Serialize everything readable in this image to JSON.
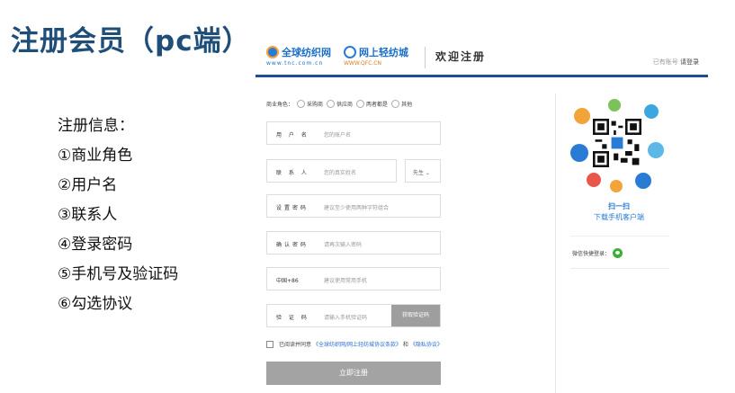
{
  "slide": {
    "title": "注册会员（pc端）",
    "info_heading": "注册信息：",
    "info_items": [
      "①商业角色",
      "②用户名",
      "③联系人",
      "④登录密码",
      "⑤手机号及验证码",
      "⑥勾选协议"
    ]
  },
  "header": {
    "logo1_name": "全球纺织网",
    "logo1_url": "www.tnc.com.cn",
    "logo2_name": "网上轻纺城",
    "logo2_url": "WWW.QFC.CN",
    "welcome": "欢迎注册",
    "login_prompt": "已有账号",
    "login_link": "请登录"
  },
  "form": {
    "role_label": "商业角色：",
    "roles": [
      "采购商",
      "供应商",
      "两者都是",
      "其他"
    ],
    "username": {
      "label": "用 户 名",
      "placeholder": "您的账户名"
    },
    "contact": {
      "label": "联 系 人",
      "placeholder": "您的真实姓名",
      "salutation": "先生 ⌄"
    },
    "password": {
      "label": "设置密码",
      "placeholder": "建议至少使用两种字符组合"
    },
    "confirm": {
      "label": "确认密码",
      "placeholder": "请再次输入密码"
    },
    "phone": {
      "label": "中国+86",
      "placeholder": "建议使用常用手机"
    },
    "code": {
      "label": "验 证 码",
      "placeholder": "请输入手机验证码",
      "button": "获取验证码"
    },
    "agree_text": "已阅读并同意",
    "agree_link1": "《全球纺织网/网上轻纺城协议条款》",
    "agree_and": "和",
    "agree_link2": "《隐私协议》",
    "submit": "立即注册"
  },
  "side": {
    "scan_title": "扫一扫",
    "scan_sub": "下载手机客户端",
    "wechat_login": "微信快捷登录："
  },
  "colors": {
    "title": "#1f4e79",
    "brand": "#1a4f93",
    "link": "#2a7bd3",
    "button": "#a3a3a3"
  }
}
